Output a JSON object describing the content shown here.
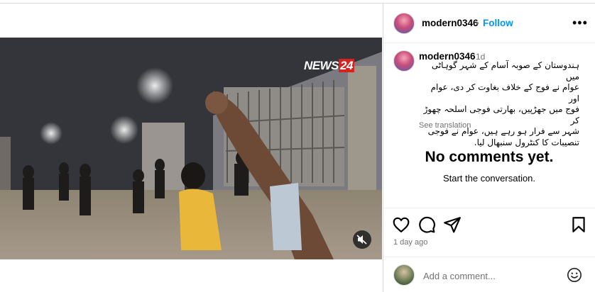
{
  "post": {
    "username": "modern0346",
    "separator": "•",
    "follow_label": "Follow",
    "more_label": "•••",
    "caption_username": "modern0346",
    "caption_time": "1d",
    "caption_lines": [
      "ہندوستان کے صوبہ آسام کے شہر گوہاٹی میں",
      "عوام نے فوج کے خلاف بغاوت کر دی، عوام اور",
      "فوج میں جھڑپیں، بھارتی فوجی اسلحہ چھوڑ کر",
      "شہر سے فرار ہو رہے ہیں، عوام نے فوجی",
      "تنصیبات کا کنٹرول سنبھال لیا."
    ],
    "see_translation": "See translation",
    "no_comments_title": "No comments yet.",
    "no_comments_sub": "Start the conversation.",
    "posted_ago": "1 day ago",
    "add_comment_placeholder": "Add a comment..."
  },
  "video": {
    "logo_text": "NEWS",
    "logo_num": "24"
  },
  "icons": {
    "like": "heart-icon",
    "comment": "comment-icon",
    "share": "share-icon",
    "save": "bookmark-icon",
    "emoji": "emoji-icon",
    "mute": "mute-icon"
  },
  "colors": {
    "accent": "#0095f6",
    "muted_text": "#737373",
    "border": "#dbdbdb"
  }
}
